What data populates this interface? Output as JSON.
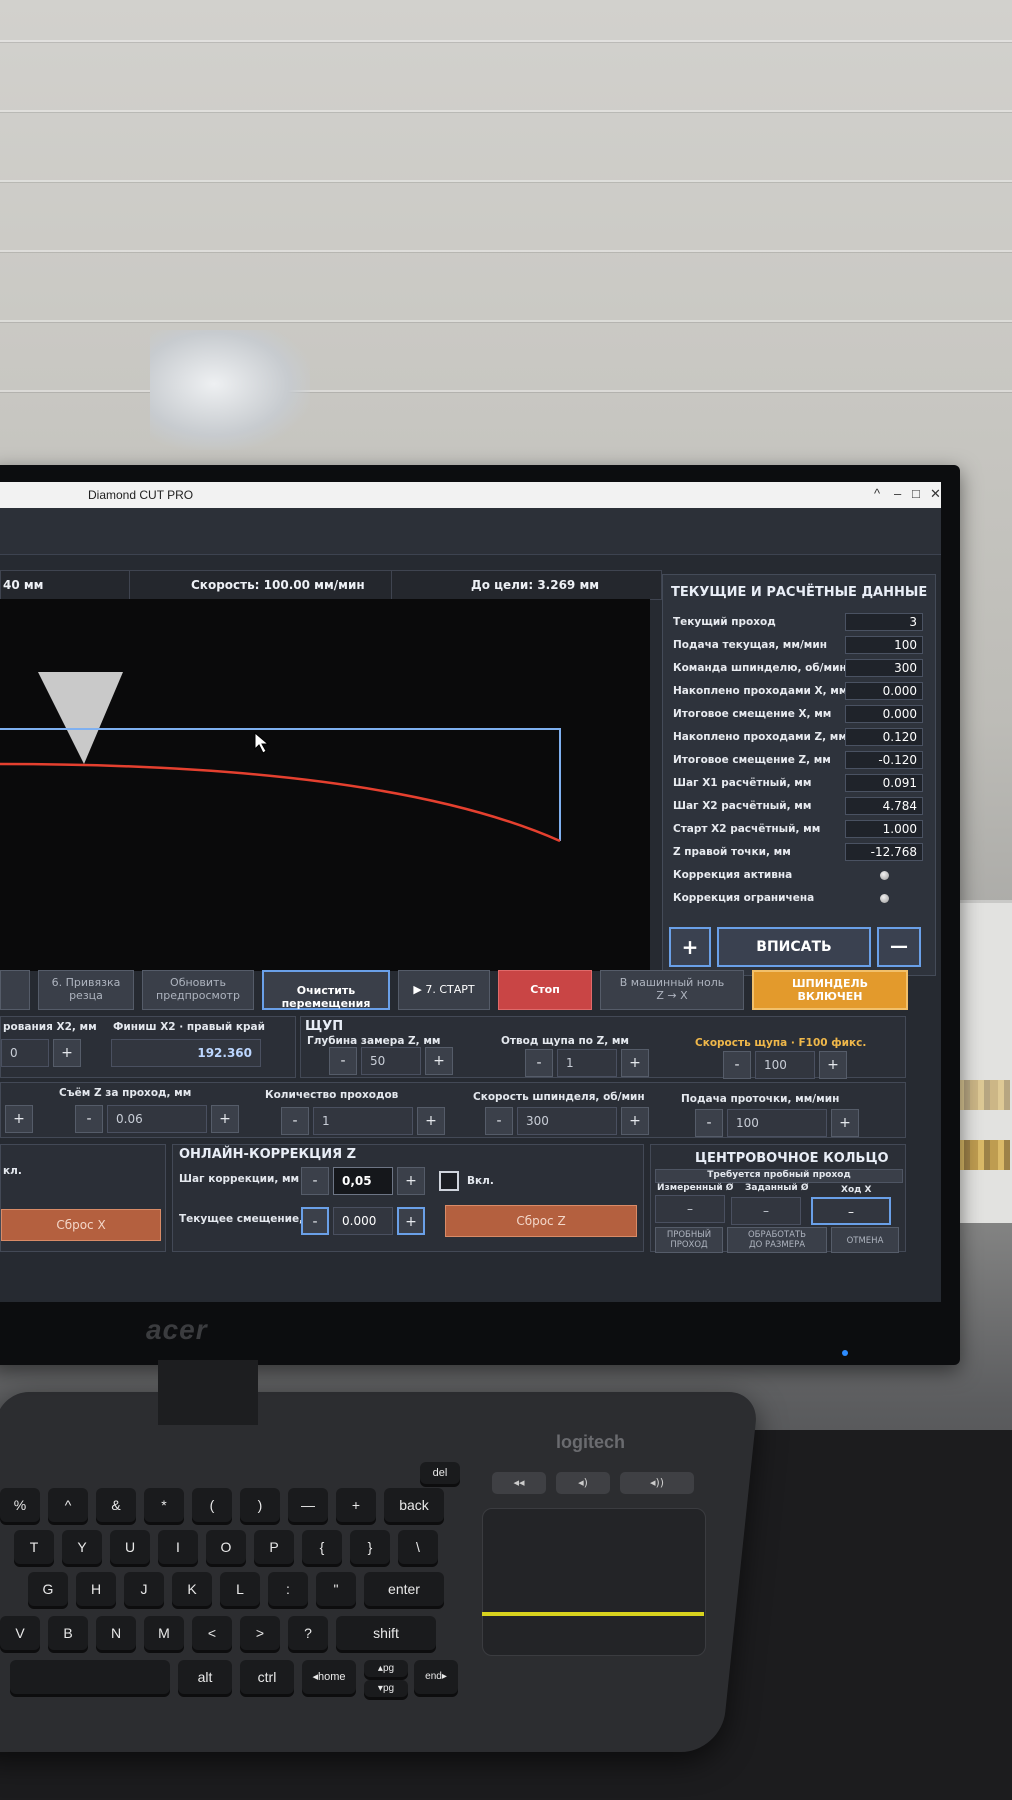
{
  "window": {
    "title": "Diamond CUT PRO",
    "controls": {
      "minimize": "–",
      "restore": "□",
      "close": "✕",
      "collapse": "^"
    }
  },
  "infobar": {
    "left": "40 мм",
    "speed": "Скорость: 100.00 мм/мин",
    "target": "До цели: 3.269 мм"
  },
  "data_panel": {
    "title": "ТЕКУЩИЕ И РАСЧЁТНЫЕ ДАННЫЕ",
    "rows": [
      {
        "label": "Текущий проход",
        "value": "3"
      },
      {
        "label": "Подача текущая, мм/мин",
        "value": "100"
      },
      {
        "label": "Команда шпинделю, об/мин",
        "value": "300"
      },
      {
        "label": "Накоплено проходами X, мм",
        "value": "0.000"
      },
      {
        "label": "Итоговое смещение X, мм",
        "value": "0.000"
      },
      {
        "label": "Накоплено проходами Z, мм",
        "value": "0.120"
      },
      {
        "label": "Итоговое смещение Z, мм",
        "value": "-0.120"
      },
      {
        "label": "Шаг X1 расчётный, мм",
        "value": "0.091"
      },
      {
        "label": "Шаг X2 расчётный, мм",
        "value": "4.784"
      },
      {
        "label": "Старт X2 расчётный, мм",
        "value": "1.000"
      },
      {
        "label": "Z правой точки, мм",
        "value": "-12.768"
      }
    ],
    "flags": [
      {
        "label": "Коррекция активна"
      },
      {
        "label": "Коррекция ограничена"
      }
    ],
    "plus": "+",
    "inscribe": "ВПИСАТЬ",
    "minus": "—"
  },
  "toolbar": {
    "bind_cutter": "6. Привязка\nрезца",
    "refresh_preview": "Обновить\nпредпросмотр",
    "clear_moves": "Очистить перемещения",
    "start": "7. СТАРТ",
    "stop": "Стоп",
    "machine_zero": "В машинный ноль\nZ → X",
    "spindle": "ШПИНДЕЛЬ\nВКЛЮЧЕН"
  },
  "params_x": {
    "label_x2": "рования X2, мм",
    "finish_label": "Финиш X2 · правый край",
    "finish_value": "192.360",
    "small_value": "0"
  },
  "probe": {
    "title": "ЩУП",
    "depth_label": "Глубина замера Z, мм",
    "depth_value": "50",
    "retract_label": "Отвод щупа по Z, мм",
    "retract_value": "1",
    "speed_label": "Скорость щупа · F100 фикс.",
    "speed_value": "100"
  },
  "passes": {
    "z_removal_label": "Съём Z за проход, мм",
    "z_removal_value": "0.06",
    "count_label": "Количество проходов",
    "count_value": "1",
    "spindle_label": "Скорость шпинделя, об/мин",
    "spindle_value": "300",
    "feed_label": "Подача проточки, мм/мин",
    "feed_value": "100"
  },
  "online_z": {
    "title": "ОНЛАЙН-КОРРЕКЦИЯ Z",
    "step_label": "Шаг коррекции, мм",
    "step_value": "0,05",
    "enable_label": "Вкл.",
    "offset_label": "Текущее смещение, мм",
    "offset_value": "0.000",
    "reset_z": "Сброс Z",
    "left_enable": "кл.",
    "reset_x": "Сброс X"
  },
  "ring": {
    "title": "ЦЕНТРОВОЧНОЕ КОЛЬЦО",
    "warning": "Требуется пробный проход",
    "measured": "Измеренный Ø",
    "target": "Заданный Ø",
    "travel": "Ход X",
    "measured_val": "–",
    "target_val": "–",
    "travel_val": "–",
    "test_pass": "ПРОБНЫЙ\nПРОХОД",
    "process": "ОБРАБОТАТЬ\nДО РАЗМЕРА",
    "cancel": "ОТМЕНА"
  },
  "monitor_brand": "acer",
  "keyboard_brand": "logitech",
  "keys": {
    "backspace": "back",
    "enter": "enter",
    "shift": "shift",
    "alt": "alt",
    "ctrl": "ctrl",
    "home": "◂home",
    "end": "end▸",
    "del": "del",
    "pgup": "▴pg",
    "pgdn": "▾pg",
    "row1": [
      "%",
      "^",
      "&",
      "*",
      "(",
      ")",
      "—",
      "+"
    ],
    "row2": [
      "T",
      "Y",
      "U",
      "I",
      "O",
      "P",
      "{",
      "}",
      "\\"
    ],
    "row3": [
      "G",
      "H",
      "J",
      "K",
      "L",
      ":",
      "\""
    ],
    "row4": [
      "V",
      "B",
      "N",
      "M",
      "<",
      ">",
      "?"
    ]
  },
  "colors": {
    "accent_blue": "#6aa0e8",
    "stop_red": "#c94545",
    "spindle_orange": "#e39a2c",
    "profile_red": "#e5402f",
    "profile_blue": "#7fb0f0",
    "reset_brown": "#b4603f"
  }
}
